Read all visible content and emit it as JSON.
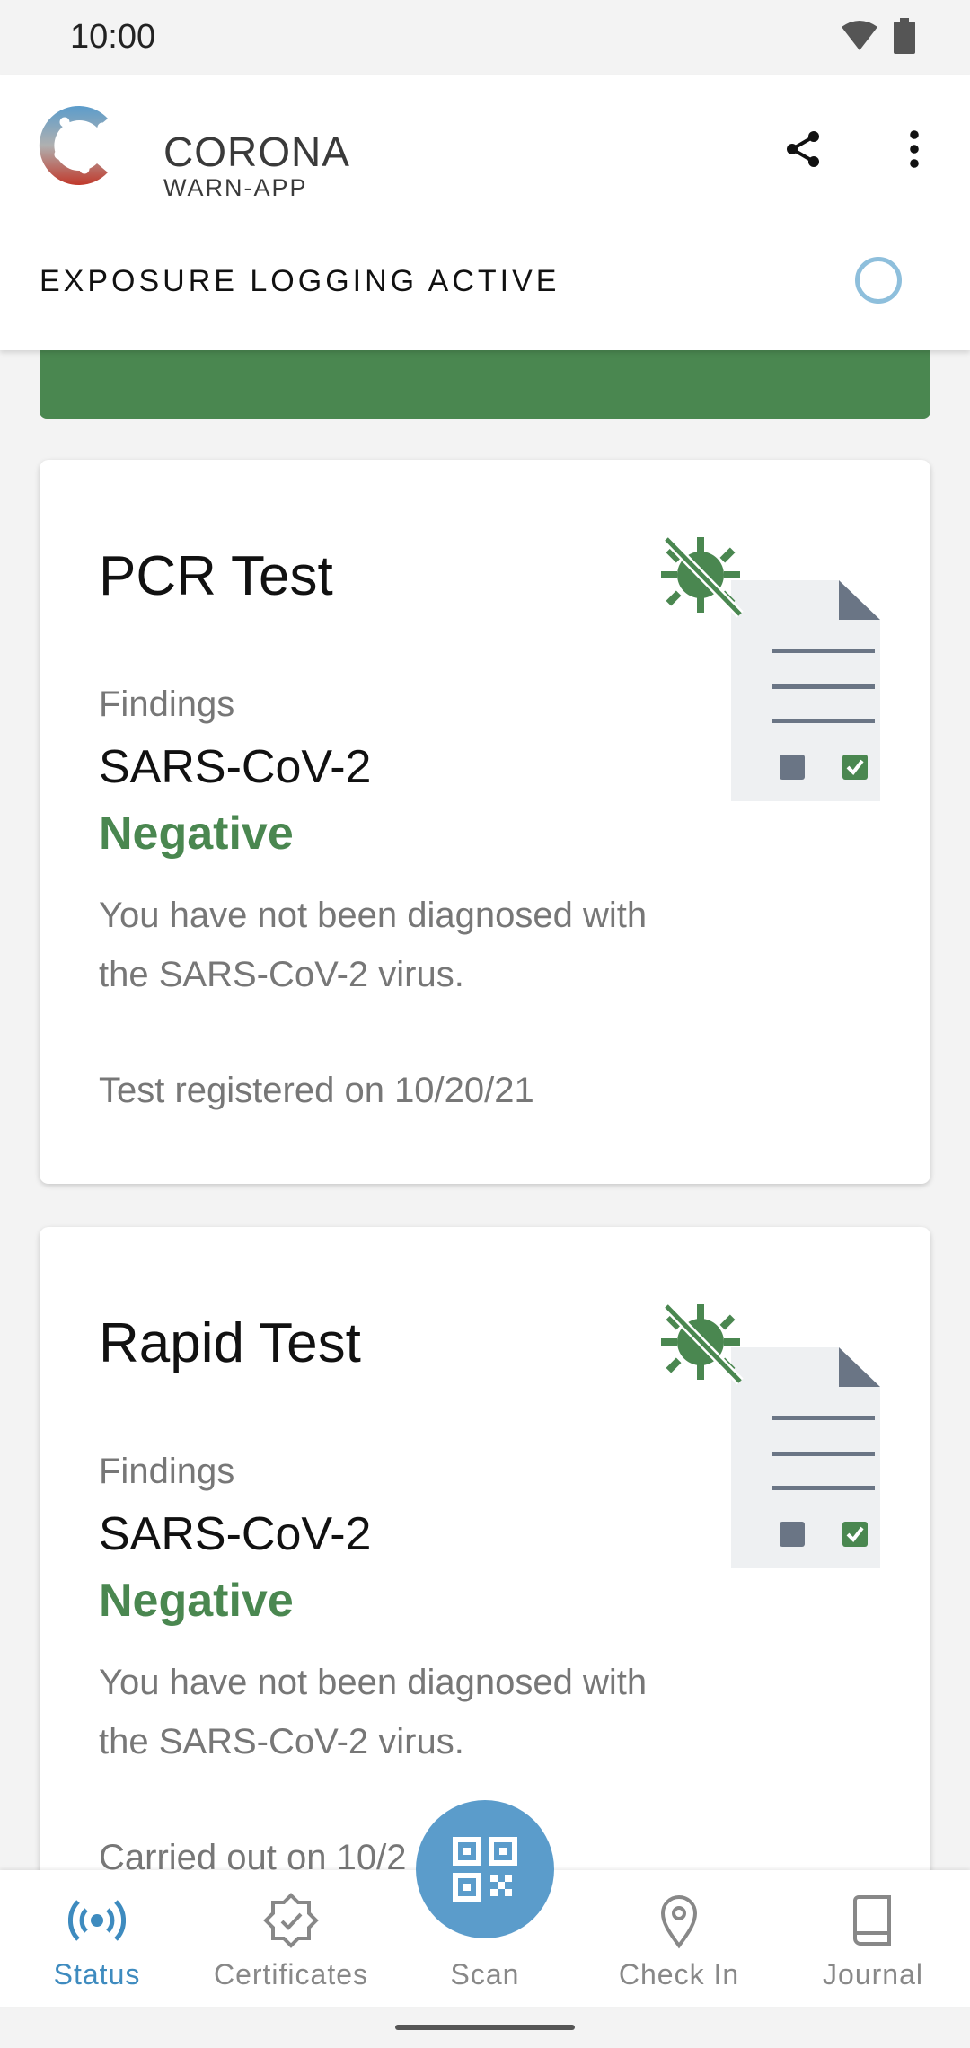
{
  "status_bar": {
    "time": "10:00",
    "icons": [
      "wifi-icon",
      "battery-icon"
    ]
  },
  "header": {
    "logo_line1": "CORONA",
    "logo_line2": "WARN-APP",
    "share_icon": "share-icon",
    "more_icon": "more-vert-icon",
    "exposure_status": "EXPOSURE LOGGING ACTIVE"
  },
  "colors": {
    "accent_green": "#4a8750",
    "accent_blue": "#5b9ccb",
    "active_nav": "#3e8bbf"
  },
  "cards": [
    {
      "title": "PCR Test",
      "findings_label": "Findings",
      "virus": "SARS-CoV-2",
      "result": "Negative",
      "description": "You have not been diagnosed with the SARS-CoV-2 virus.",
      "date_text": "Test registered on 10/20/21"
    },
    {
      "title": "Rapid Test",
      "findings_label": "Findings",
      "virus": "SARS-CoV-2",
      "result": "Negative",
      "description": "You have not been diagnosed with the SARS-CoV-2 virus.",
      "date_text": "Carried out on 10/2"
    }
  ],
  "bottom_nav": {
    "items": [
      {
        "label": "Status",
        "icon": "broadcast-icon",
        "active": true
      },
      {
        "label": "Certificates",
        "icon": "certificate-badge-icon",
        "active": false
      },
      {
        "label": "Scan",
        "icon": "qr-code-icon",
        "active": false
      },
      {
        "label": "Check In",
        "icon": "location-pin-icon",
        "active": false
      },
      {
        "label": "Journal",
        "icon": "book-icon",
        "active": false
      }
    ]
  }
}
